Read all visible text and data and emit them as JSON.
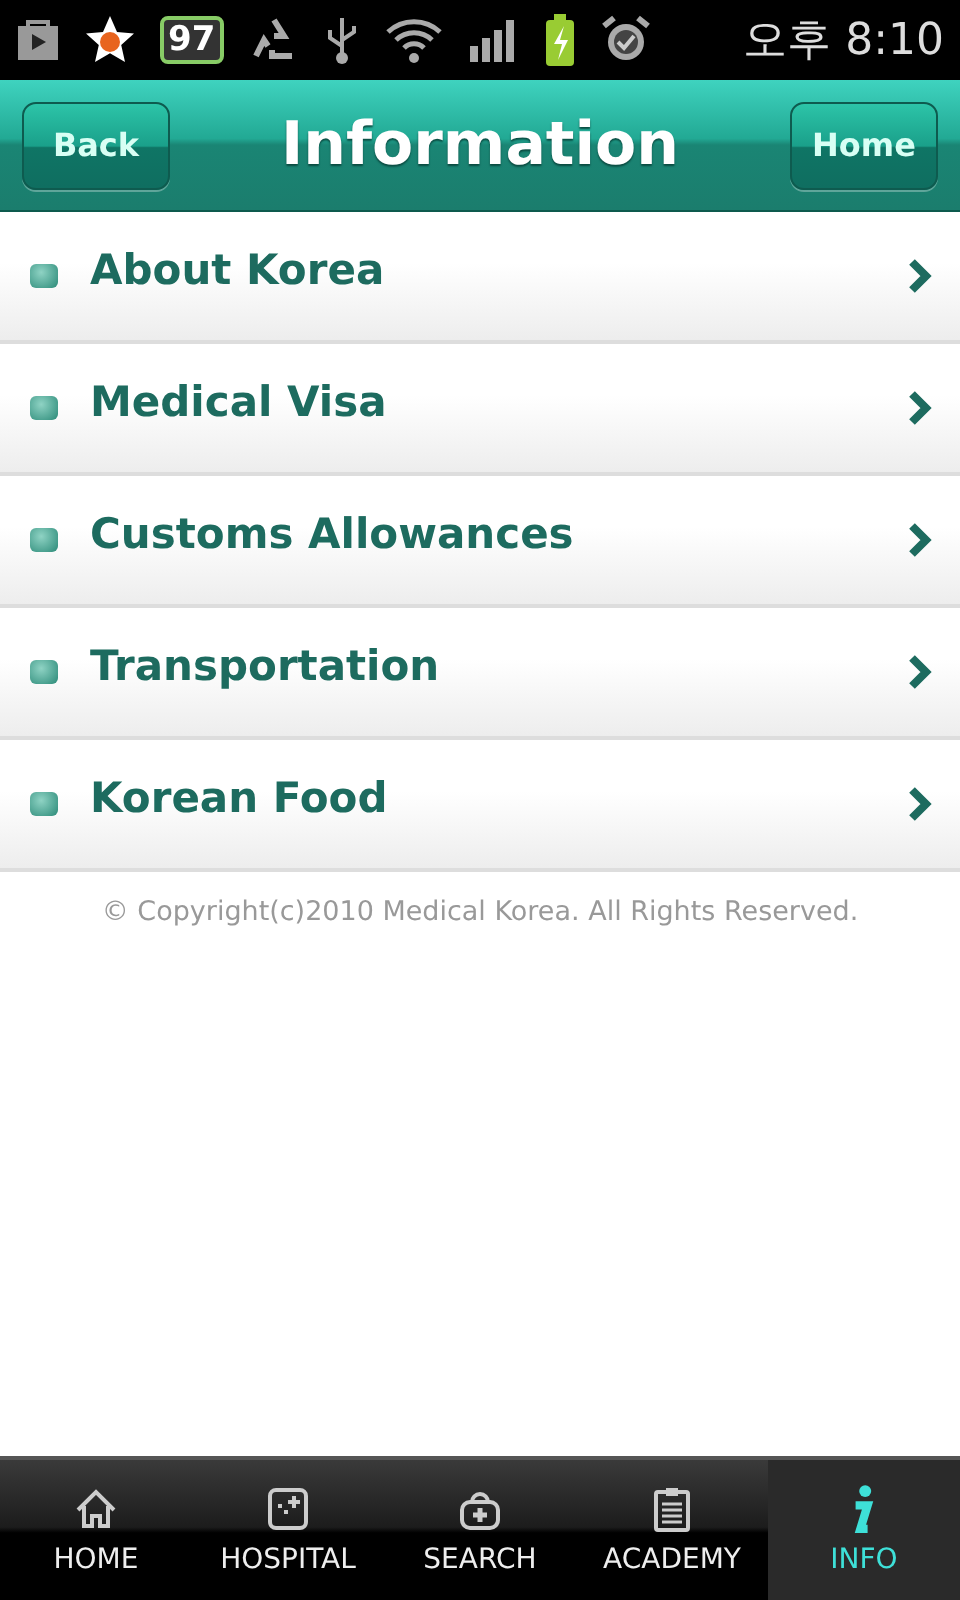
{
  "status_bar": {
    "notification_badge": "97",
    "time": "오후 8:10"
  },
  "header": {
    "back": "Back",
    "title": "Information",
    "home": "Home"
  },
  "menu": [
    {
      "label": "About Korea"
    },
    {
      "label": "Medical Visa"
    },
    {
      "label": "Customs Allowances"
    },
    {
      "label": "Transportation"
    },
    {
      "label": "Korean Food"
    }
  ],
  "copyright": "© Copyright(c)2010 Medical Korea. All Rights Reserved.",
  "tabs": [
    {
      "label": "HOME",
      "kind": "home",
      "selected": false
    },
    {
      "label": "HOSPITAL",
      "kind": "hospital",
      "selected": false
    },
    {
      "label": "SEARCH",
      "kind": "search",
      "selected": false
    },
    {
      "label": "ACADEMY",
      "kind": "academy",
      "selected": false
    },
    {
      "label": "INFO",
      "kind": "info",
      "selected": true
    }
  ]
}
